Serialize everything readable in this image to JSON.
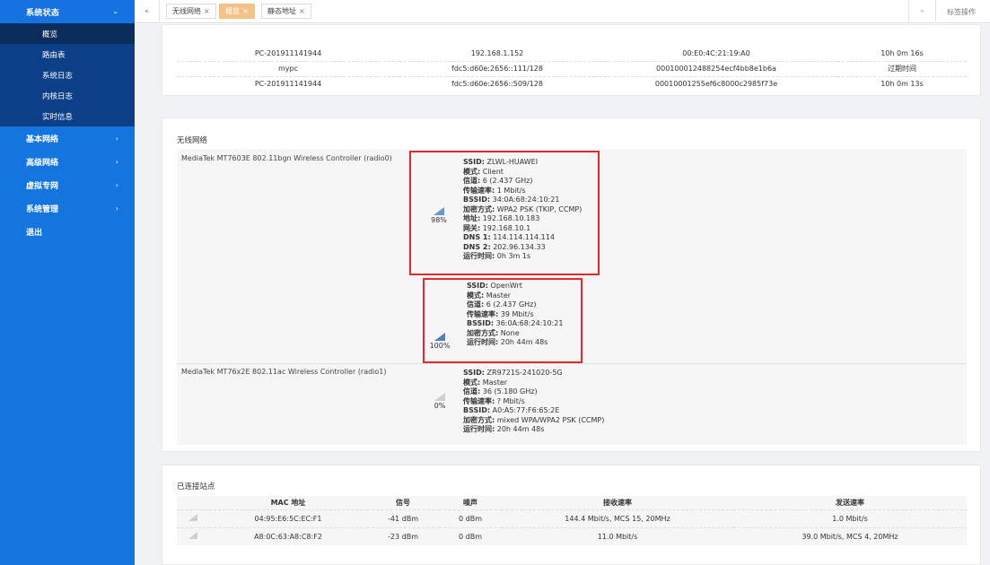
{
  "sidebar": {
    "section_title": "系统状态",
    "sub_items": [
      "概览",
      "路由表",
      "系统日志",
      "内核日志",
      "实时信息"
    ],
    "groups": [
      "基本网络",
      "高级网络",
      "虚拟专网",
      "系统管理",
      "退出"
    ]
  },
  "tabbar": {
    "tabs": [
      {
        "label": "无线网络"
      },
      {
        "label": "概览"
      },
      {
        "label": "静态地址"
      }
    ],
    "ops_label": "标签操作"
  },
  "hosts": {
    "rows": [
      [
        "PC-201911141944",
        "192.168.1.152",
        "00:E0:4C:21:19:A0",
        "10h 0m 16s"
      ],
      [
        "mypc",
        "fdc5:d60e:2656::111/128",
        "000100012488254ecf4bb8e1b6a",
        "过期时间"
      ],
      [
        "PC-201911141944",
        "fdc5:d60e:2656::509/128",
        "00010001255ef6c8000c2985f73e",
        "10h 0m 13s"
      ]
    ]
  },
  "wireless": {
    "title": "无线网络",
    "radio0": "MediaTek MT7603E 802.11bgn Wireless Controller (radio0)",
    "radio1": "MediaTek MT76x2E 802.11ac Wireless Controller (radio1)",
    "networks": [
      {
        "signal": "98%",
        "lines": [
          {
            "k": "SSID:",
            "v": " ZLWL-HUAWEI"
          },
          {
            "k": "模式:",
            "v": " Client"
          },
          {
            "k": "信道:",
            "v": " 6 (2.437 GHz)"
          },
          {
            "k": "传输速率:",
            "v": " 1 Mbit/s"
          },
          {
            "k": "BSSID:",
            "v": " 34:0A:68:24:10:21"
          },
          {
            "k": "加密方式:",
            "v": " WPA2 PSK (TKIP, CCMP)"
          },
          {
            "k": "地址:",
            "v": " 192.168.10.183"
          },
          {
            "k": "网关:",
            "v": " 192.168.10.1"
          },
          {
            "k": "DNS 1:",
            "v": " 114.114.114.114"
          },
          {
            "k": "DNS 2:",
            "v": " 202.96.134.33"
          },
          {
            "k": "运行时间:",
            "v": " 0h 3m 1s"
          }
        ]
      },
      {
        "signal": "100%",
        "lines": [
          {
            "k": "SSID:",
            "v": " OpenWrt"
          },
          {
            "k": "模式:",
            "v": " Master"
          },
          {
            "k": "信道:",
            "v": " 6 (2.437 GHz)"
          },
          {
            "k": "传输速率:",
            "v": " 39 Mbit/s"
          },
          {
            "k": "BSSID:",
            "v": " 36:0A:68:24:10:21"
          },
          {
            "k": "加密方式:",
            "v": " None"
          },
          {
            "k": "运行时间:",
            "v": " 20h 44m 48s"
          }
        ]
      },
      {
        "signal": "0%",
        "lines": [
          {
            "k": "SSID:",
            "v": " ZR9721S-241020-5G"
          },
          {
            "k": "模式:",
            "v": " Master"
          },
          {
            "k": "信道:",
            "v": " 36 (5.180 GHz)"
          },
          {
            "k": "传输速率:",
            "v": " ? Mbit/s"
          },
          {
            "k": "BSSID:",
            "v": " A0:A5:77:F6:65:2E"
          },
          {
            "k": "加密方式:",
            "v": " mixed WPA/WPA2 PSK (CCMP)"
          },
          {
            "k": "运行时间:",
            "v": " 20h 44m 48s"
          }
        ]
      }
    ]
  },
  "assoc": {
    "title": "已连接站点",
    "headers": [
      "",
      "MAC 地址",
      "信号",
      "噪声",
      "接收速率",
      "发送速率"
    ],
    "rows": [
      [
        "04:95:E6:5C:EC:F1",
        "-41 dBm",
        "0 dBm",
        "144.4 Mbit/s, MCS 15, 20MHz",
        "1.0 Mbit/s"
      ],
      [
        "A8:0C:63:A8:C8:F2",
        "-23 dBm",
        "0 dBm",
        "11.0 Mbit/s",
        "39.0 Mbit/s, MCS 4, 20MHz"
      ]
    ]
  },
  "colors": {
    "sidebar": "#1475df",
    "submenu": "#0c3f88",
    "active_tab": "#f3c38a",
    "highlight": "#e0292e"
  }
}
